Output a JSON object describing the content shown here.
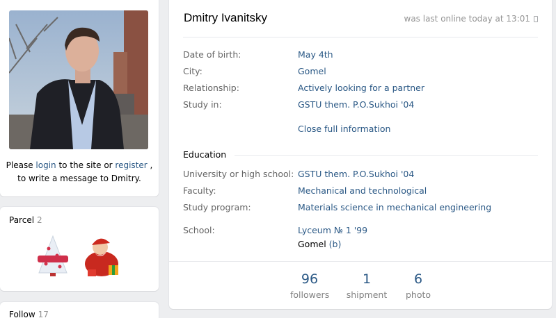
{
  "profile": {
    "name": "Dmitry Ivanitsky",
    "last_online": "was last online today at 13:01"
  },
  "login_note": {
    "before": "Please ",
    "login": "login",
    "middle": " to the site or ",
    "register": "register",
    "after": " ,",
    "line2": "to write a message to Dmitry."
  },
  "info": [
    {
      "label": "Date of birth:",
      "value": "May 4th"
    },
    {
      "label": "City:",
      "value": "Gomel"
    },
    {
      "label": "Relationship:",
      "value": "Actively looking for a partner"
    },
    {
      "label": "Study in:",
      "value": "GSTU them. P.O.Sukhoi '04"
    }
  ],
  "close_info": "Close full information",
  "education": {
    "heading": "Education",
    "rows": [
      {
        "label": "University or high school:",
        "value": "GSTU them. P.O.Sukhoi '04"
      },
      {
        "label": "Faculty:",
        "value": "Mechanical and technological"
      },
      {
        "label": "Study program:",
        "value": "Materials science in mechanical engineering"
      },
      {
        "label": "School:",
        "value": "Lyceum № 1 '99"
      }
    ],
    "school_city": "Gomel",
    "school_suffix": "(b)"
  },
  "counters": [
    {
      "num": "96",
      "label": "followers"
    },
    {
      "num": "1",
      "label": "shipment"
    },
    {
      "num": "6",
      "label": "photo"
    }
  ],
  "parcel": {
    "title": "Parcel",
    "count": "2"
  },
  "follow": {
    "title": "Follow",
    "count": "17"
  },
  "colors": {
    "link": "#2a5885",
    "background": "#edeef0",
    "muted": "#939393"
  }
}
